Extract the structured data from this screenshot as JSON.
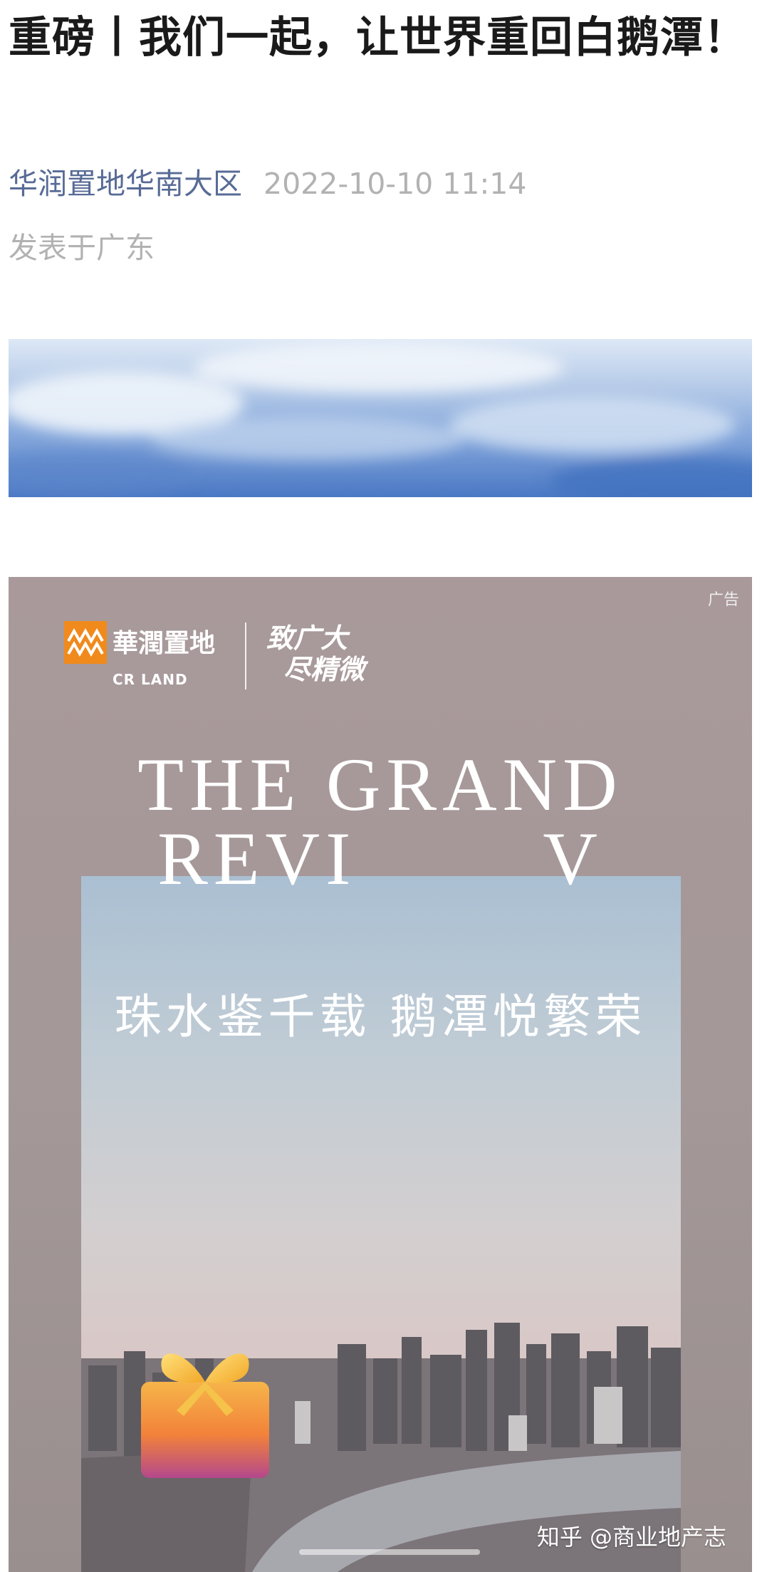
{
  "article": {
    "title": "重磅丨我们一起，让世界重回白鹅潭！",
    "author": "华润置地华南大区",
    "datetime": "2022-10-10 11:14",
    "location": "发表于广东"
  },
  "ad": {
    "tag": "广告",
    "brand_cn": "華潤置地",
    "brand_en": "CR LAND",
    "slogan_line1": "致广大",
    "slogan_line2": "尽精微",
    "title_line1": "THE GRAND",
    "title_line2a": "REVI",
    "title_line2b": "V",
    "headline": "珠水鉴千载 鹅潭悦繁荣"
  },
  "watermark": "知乎 @商业地产志",
  "colors": {
    "author_link": "#576b95",
    "meta_gray": "#b2b2b2",
    "brand_orange": "#f08a1c"
  }
}
